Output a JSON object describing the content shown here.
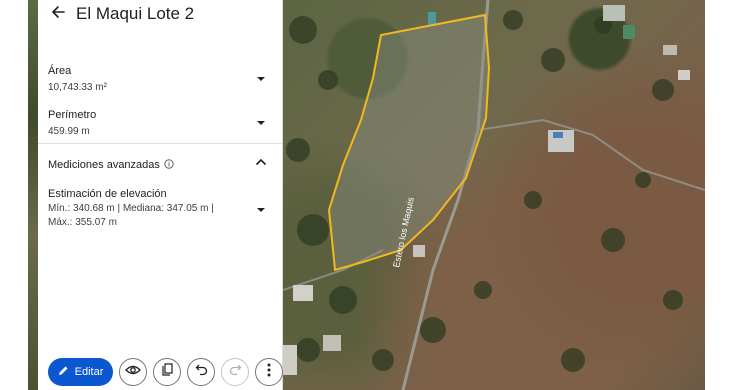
{
  "header": {
    "title": "El Maqui Lote 2"
  },
  "area": {
    "label": "Área",
    "value": "10,743.33 m²"
  },
  "perimeter": {
    "label": "Perímetro",
    "value": "459.99 m"
  },
  "advanced": {
    "label": "Mediciones avanzadas"
  },
  "elevation": {
    "label": "Estimación de elevación",
    "line1": "Mín.: 340.68 m | Mediana: 347.05 m |",
    "line2": "Máx.: 355.07 m"
  },
  "toolbar": {
    "edit_label": "Editar"
  },
  "map": {
    "road_label": "Estero los Maquis",
    "polygon_color": "#f2b81e"
  }
}
